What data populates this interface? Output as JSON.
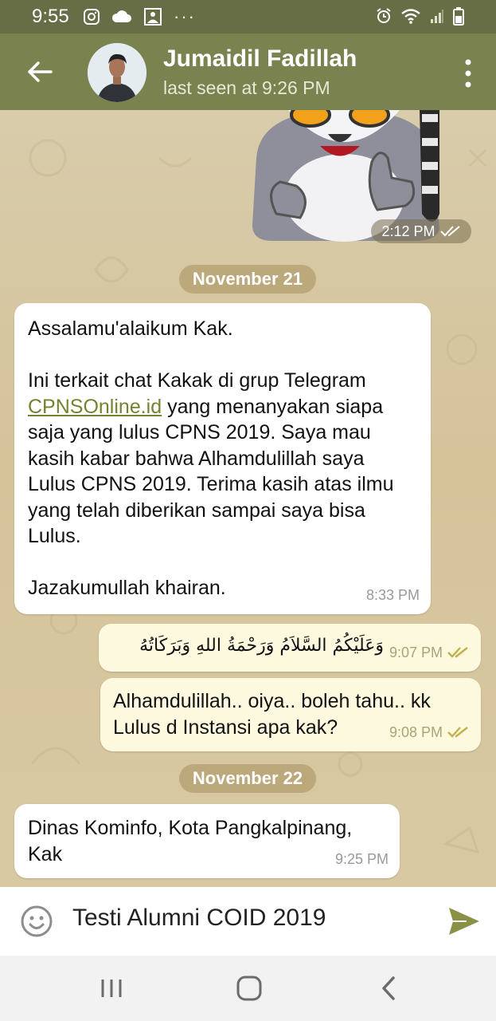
{
  "status_bar": {
    "time": "9:55",
    "left_icons": [
      "instagram-icon",
      "cloud-icon",
      "photo-icon",
      "more-dots-icon"
    ],
    "right_icons": [
      "alarm-icon",
      "wifi-icon",
      "signal-icon",
      "battery-icon"
    ]
  },
  "header": {
    "contact_name": "Jumaidil Fadillah",
    "status": "last seen at 9:26 PM",
    "back_icon": "back-arrow-icon",
    "menu_icon": "more-vert-icon"
  },
  "messages": {
    "sticker": {
      "time": "2:12 PM",
      "read": true
    },
    "date1": "November 21",
    "m1": {
      "line1": "Assalamu'alaikum Kak.",
      "link": "CPNSOnline.id",
      "text_before_link": "Ini terkait chat Kakak di grup Telegram",
      "text_after_link": " yang menanyakan siapa saja yang lulus CPNS 2019. Saya mau kasih kabar bahwa Alhamdulillah saya Lulus CPNS 2019. Terima kasih atas ilmu yang telah diberikan sampai saya bisa Lulus.",
      "closing": "Jazakumullah khairan.",
      "time": "8:33 PM"
    },
    "m2": {
      "text": "وَعَلَيْكُمُ السَّلاَمُ وَرَحْمَةُ اللهِ وَبَرَكَاتُهُ",
      "time": "9:07 PM"
    },
    "m3": {
      "text": "Alhamdulillah.. oiya.. boleh tahu.. kk Lulus d Instansi apa kak?",
      "time": "9:08 PM"
    },
    "date2": "November 22",
    "m4": {
      "text": "Dinas Kominfo, Kota Pangkalpinang, Kak",
      "time": "9:25 PM"
    }
  },
  "composer": {
    "value": "Testi Alumni COID 2019",
    "emoji_icon": "emoji-icon",
    "send_icon": "send-icon"
  },
  "navigation": {
    "recent_icon": "recent-apps-icon",
    "home_icon": "home-icon",
    "back_icon": "nav-back-icon"
  },
  "colors": {
    "header": "#7a824f",
    "status_bar": "#676d45",
    "outgoing_bubble": "#fcf9de",
    "incoming_bubble": "#ffffff",
    "link": "#77822f",
    "date_pill": "#bca97b",
    "check": "#c3b04a",
    "send": "#8a9145"
  }
}
